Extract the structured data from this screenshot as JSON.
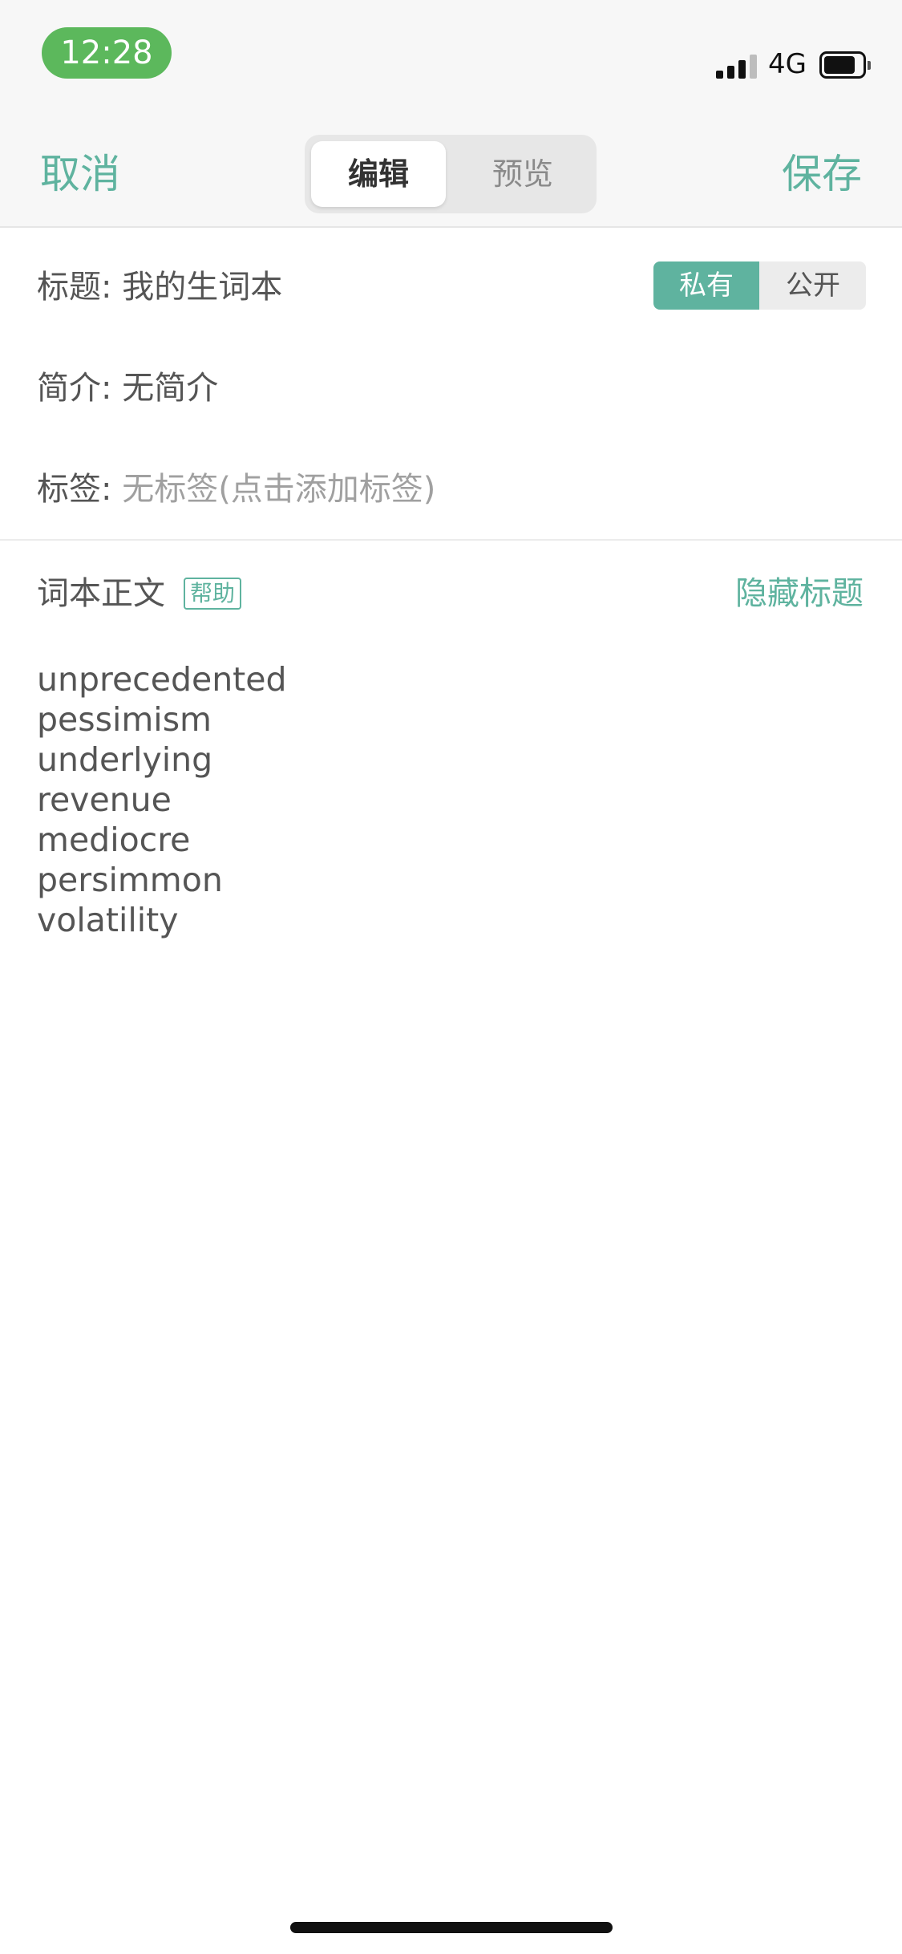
{
  "status_bar": {
    "time": "12:28",
    "network": "4G",
    "accent_color": "#5cb85c",
    "icons": [
      "signal-icon",
      "battery-icon"
    ]
  },
  "nav": {
    "cancel_label": "取消",
    "save_label": "保存",
    "segments": [
      {
        "label": "编辑",
        "selected": true
      },
      {
        "label": "预览",
        "selected": false
      }
    ],
    "accent_color": "#5fb39f"
  },
  "form": {
    "title": {
      "label": "标题:",
      "value": "我的生词本"
    },
    "privacy": {
      "private_label": "私有",
      "public_label": "公开",
      "selected": "私有"
    },
    "description": {
      "label": "简介:",
      "value": "无简介"
    },
    "tags": {
      "label": "标签:",
      "placeholder": "无标签(点击添加标签)"
    }
  },
  "body": {
    "header": "词本正文",
    "help_label": "帮助",
    "hide_title_label": "隐藏标题",
    "words": [
      "unprecedented",
      "pessimism",
      "underlying",
      "revenue",
      "mediocre",
      "persimmon",
      "volatility"
    ]
  }
}
